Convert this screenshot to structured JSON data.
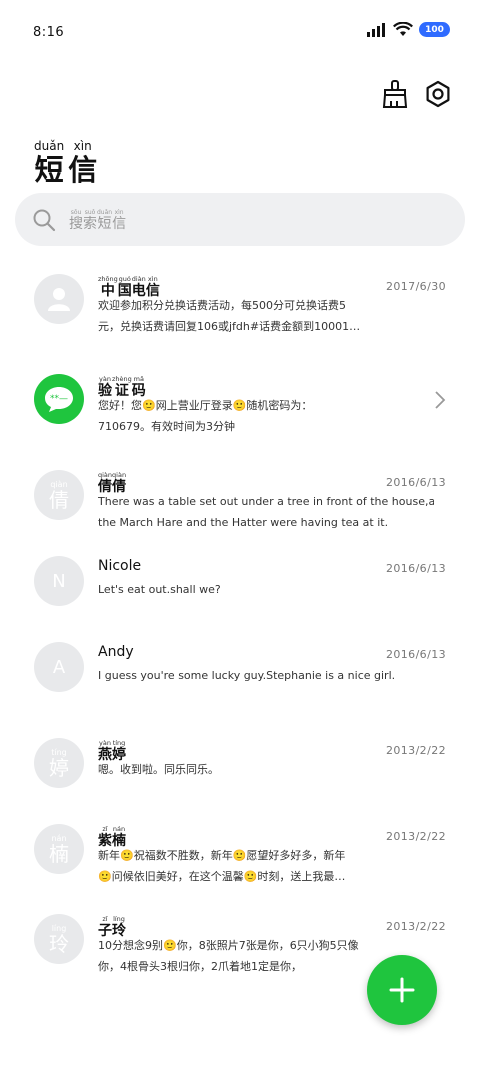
{
  "status": {
    "time": "8:16",
    "battery": "100"
  },
  "header": {
    "title": [
      {
        "py": "duǎn",
        "hz": "短"
      },
      {
        "py": "xìn",
        "hz": "信"
      }
    ]
  },
  "search": {
    "placeholder": [
      {
        "py": "sōu",
        "hz": "搜"
      },
      {
        "py": "suǒ",
        "hz": "索"
      },
      {
        "py": "duǎn",
        "hz": "短"
      },
      {
        "py": "xìn",
        "hz": "信"
      }
    ]
  },
  "colors": {
    "accent": "#1fc53e",
    "battery": "#2f6bff",
    "avatar_bg": "#e8e9eb"
  },
  "messages": [
    {
      "avatar": {
        "type": "icon",
        "icon": "person-icon"
      },
      "name": [
        {
          "py": "zhōng",
          "hz": "中"
        },
        {
          "py": "guó",
          "hz": "国"
        },
        {
          "py": "diàn",
          "hz": "电"
        },
        {
          "py": "xìn",
          "hz": "信"
        }
      ],
      "date": "2017/6/30",
      "lines": [
        "欢迎参加积分兑换话费活动，每500分可兑换话费5",
        "元，兑换话费请回复106或jfdh#话费金额到10001…"
      ]
    },
    {
      "avatar": {
        "type": "icon",
        "icon": "chat-bubble-icon"
      },
      "name": [
        {
          "py": "yàn",
          "hz": "验"
        },
        {
          "py": "zhèng",
          "hz": "证"
        },
        {
          "py": "mǎ",
          "hz": "码"
        }
      ],
      "date": "",
      "lines": [
        "您好！您🙂网上营业厅登录🙂随机密码为：",
        "710679。有效时间为3分钟"
      ]
    },
    {
      "avatar": {
        "type": "text",
        "py": "qiàn",
        "hz": "倩"
      },
      "name": [
        {
          "py": "qiàn",
          "hz": "倩"
        },
        {
          "py": "qiàn",
          "hz": "倩"
        }
      ],
      "date": "2016/6/13",
      "lines": [
        "There was a table set out under a tree in front of the house,and",
        "the March Hare and the Hatter were having tea at it."
      ]
    },
    {
      "avatar": {
        "type": "letter",
        "hz": "N"
      },
      "name_text": "Nicole",
      "date": "2016/6/13",
      "lines": [
        "Let's eat out.shall we?"
      ]
    },
    {
      "avatar": {
        "type": "letter",
        "hz": "A"
      },
      "name_text": "Andy",
      "date": "2016/6/13",
      "lines": [
        "I guess you're some lucky guy.Stephanie is a nice girl."
      ]
    },
    {
      "avatar": {
        "type": "text",
        "py": "tíng",
        "hz": "婷"
      },
      "name": [
        {
          "py": "yàn",
          "hz": "燕"
        },
        {
          "py": "tíng",
          "hz": "婷"
        }
      ],
      "date": "2013/2/22",
      "lines": [
        "嗯。收到啦。同乐同乐。"
      ]
    },
    {
      "avatar": {
        "type": "text",
        "py": "nán",
        "hz": "楠"
      },
      "name": [
        {
          "py": "zǐ",
          "hz": "紫"
        },
        {
          "py": "nán",
          "hz": "楠"
        }
      ],
      "date": "2013/2/22",
      "lines": [
        "新年🙂祝福数不胜数，新年🙂愿望好多好多，新年",
        "🙂问候依旧美好，在这个温馨🙂时刻，送上我最…"
      ]
    },
    {
      "avatar": {
        "type": "text",
        "py": "líng",
        "hz": "玲"
      },
      "name": [
        {
          "py": "zǐ",
          "hz": "子"
        },
        {
          "py": "líng",
          "hz": "玲"
        }
      ],
      "date": "2013/2/22",
      "lines": [
        "10分想念9别🙂你，8张照片7张是你，6只小狗5只像",
        "你，4根骨头3根归你，2爪着地1定是你，"
      ]
    }
  ]
}
